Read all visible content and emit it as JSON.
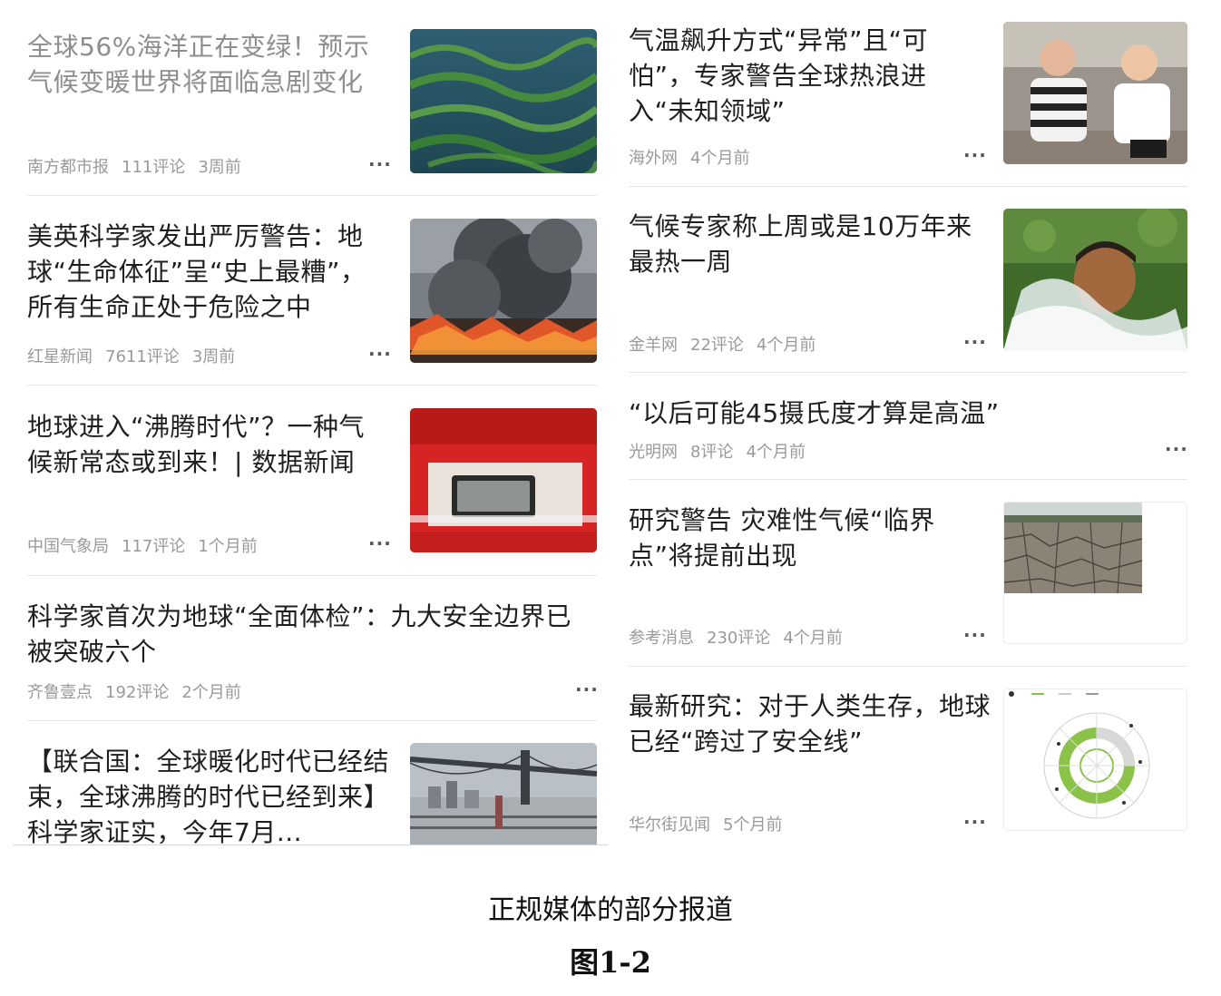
{
  "left_column": [
    {
      "title": "全球56%海洋正在变绿！预示气候变暖世界将面临急剧变化",
      "source": "南方都市报",
      "comments": "111评论",
      "time": "3周前",
      "thumb": "green-ocean-image"
    },
    {
      "title": "美英科学家发出严厉警告：地球“生命体征”呈“史上最糟”，所有生命正处于危险之中",
      "source": "红星新闻",
      "comments": "7611评论",
      "time": "3周前",
      "thumb": "wildfire-smoke-image"
    },
    {
      "title": "地球进入“沸腾时代”？一种气候新常态或到来！| 数据新闻",
      "source": "中国气象局",
      "comments": "117评论",
      "time": "1个月前",
      "thumb": "thermometer-display-image"
    },
    {
      "title": "科学家首次为地球“全面体检”：九大安全边界已被突破六个",
      "source": "齐鲁壹点",
      "comments": "192评论",
      "time": "2个月前",
      "thumb": ""
    },
    {
      "title": "【联合国：全球暖化时代已经结束，全球沸腾的时代已经到来】科学家证实，今年7月...",
      "source": "",
      "comments": "",
      "time": "",
      "thumb": "bridge-mist-image"
    }
  ],
  "right_column": [
    {
      "title": "气温飙升方式“异常”且“可怕”，专家警告全球热浪进入“未知领域”",
      "source": "海外网",
      "comments": "",
      "time": "4个月前",
      "thumb": "heatwave-people-image"
    },
    {
      "title": "气候专家称上周或是10万年来最热一周",
      "source": "金羊网",
      "comments": "22评论",
      "time": "4个月前",
      "thumb": "boy-water-splash-image"
    },
    {
      "title": "“以后可能45摄氏度才算是高温”",
      "source": "光明网",
      "comments": "8评论",
      "time": "4个月前",
      "thumb": ""
    },
    {
      "title": "研究警告 灾难性气候“临界点”将提前出现",
      "source": "参考消息",
      "comments": "230评论",
      "time": "4个月前",
      "thumb": "cracked-earth-image"
    },
    {
      "title": "最新研究：对于人类生存，地球已经“跨过了安全线”",
      "source": "华尔街见闻",
      "comments": "",
      "time": "5个月前",
      "thumb": "planetary-boundaries-diagram"
    }
  ],
  "more_glyph": "···",
  "caption": {
    "line1": "正规媒体的部分报道",
    "line2": "图1-2"
  }
}
